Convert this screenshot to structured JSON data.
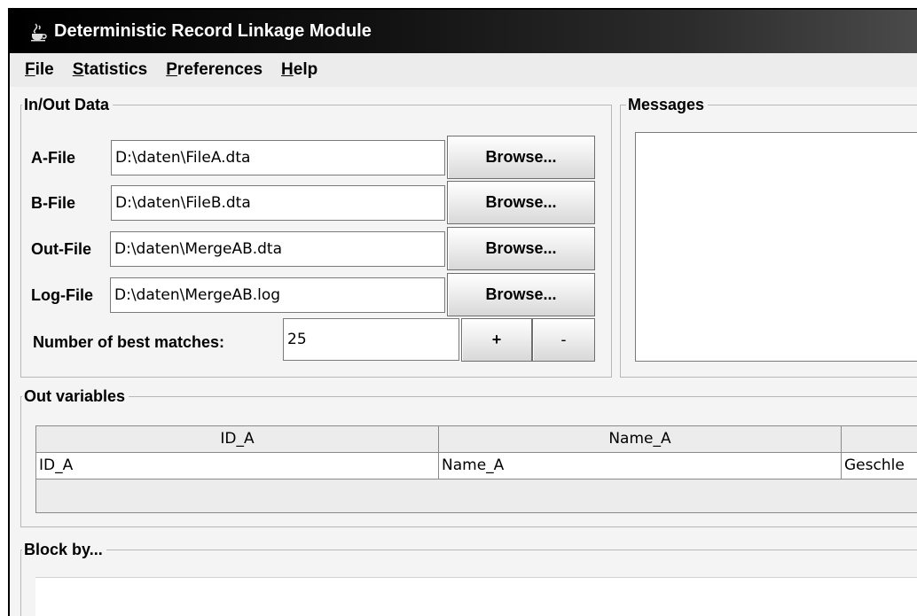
{
  "window": {
    "title": "Deterministic Record Linkage Module",
    "icon": "java-cup-icon"
  },
  "menu": [
    {
      "label": "File",
      "mnemonic": "F"
    },
    {
      "label": "Statistics",
      "mnemonic": "S"
    },
    {
      "label": "Preferences",
      "mnemonic": "P"
    },
    {
      "label": "Help",
      "mnemonic": "H"
    }
  ],
  "inout": {
    "title": "In/Out Data",
    "a_file": {
      "label": "A-File",
      "value": "D:\\daten\\FileA.dta",
      "button": "Browse..."
    },
    "b_file": {
      "label": "B-File",
      "value": "D:\\daten\\FileB.dta",
      "button": "Browse..."
    },
    "out_file": {
      "label": "Out-File",
      "value": "D:\\daten\\MergeAB.dta",
      "button": "Browse..."
    },
    "log_file": {
      "label": "Log-File",
      "value": "D:\\daten\\MergeAB.log",
      "button": "Browse..."
    },
    "best_matches": {
      "label": "Number of best matches:",
      "value": "25",
      "plus": "+",
      "minus": "-"
    }
  },
  "messages": {
    "title": "Messages"
  },
  "out_variables": {
    "title": "Out variables",
    "columns": [
      "ID_A",
      "Name_A",
      ""
    ],
    "rows": [
      [
        "ID_A",
        "Name_A",
        "Geschle"
      ]
    ]
  },
  "block_by": {
    "title": "Block by..."
  }
}
